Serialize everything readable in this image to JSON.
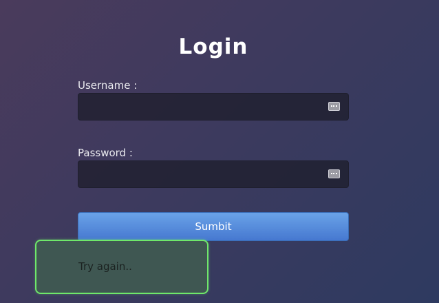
{
  "title": "Login",
  "form": {
    "username_label": "Username :",
    "username_value": "",
    "password_label": "Password :",
    "password_value": "",
    "submit_label": "Sumbit"
  },
  "icons": {
    "username_field_icon": "password-manager-key-icon",
    "password_field_icon": "password-manager-key-icon"
  },
  "toast": {
    "message": "Try again.."
  },
  "colors": {
    "background_start": "#4a3b5c",
    "background_end": "#2e3a60",
    "submit_button": "#4f86db",
    "toast_border": "#6fe86a",
    "toast_background": "#3f5752"
  }
}
